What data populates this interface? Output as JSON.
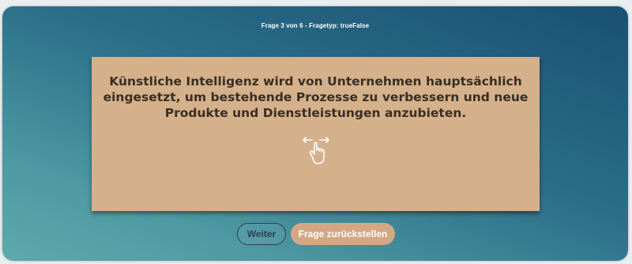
{
  "header": {
    "progress_text": "Frage 3 von 6 - Fragetyp: trueFalse"
  },
  "card": {
    "question_text": "Künstliche Intelligenz wird von Unternehmen hauptsächlich eingesetzt, um bestehende Prozesse zu verbessern und neue Produkte und Dienstleistungen anzubieten.",
    "icon": "swipe-hand-icon",
    "background_color": "#d4b18a"
  },
  "actions": {
    "next_label": "Weiter",
    "reset_label": "Frage zurückstellen"
  },
  "colors": {
    "gradient_top": "#1a5073",
    "gradient_bottom": "#5ea9ab",
    "accent": "#d4a784"
  }
}
